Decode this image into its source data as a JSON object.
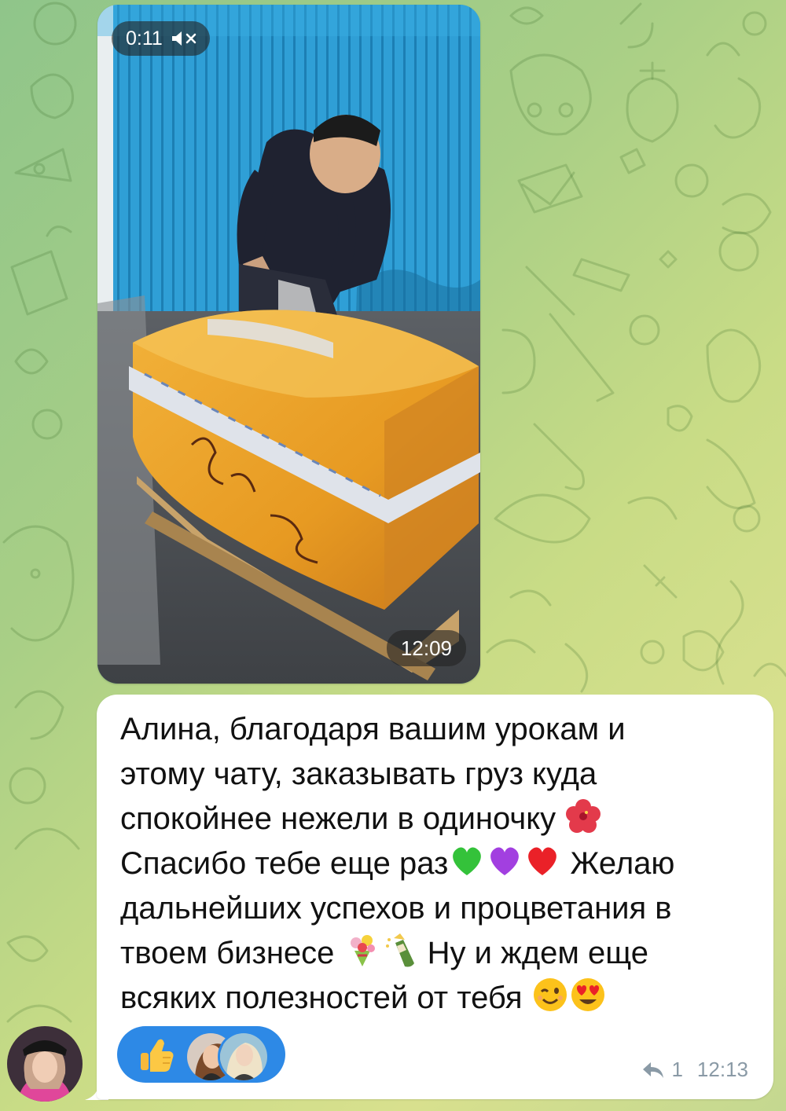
{
  "video_message": {
    "duration": "0:11",
    "sound_state_icon": "muted-speaker-icon",
    "time": "12:09"
  },
  "text_message": {
    "segments": [
      {
        "text": "Алина, благодаря вашим урокам и\nэтому чату, заказывать груз куда\nспокойнее нежели в одиночку "
      },
      {
        "emoji": "hibiscus"
      },
      {
        "text": "\nСпасибо тебе еще раз"
      },
      {
        "emoji": "green-heart"
      },
      {
        "emoji": "purple-heart"
      },
      {
        "emoji": "red-heart"
      },
      {
        "text": " Желаю\nдальнейших успехов и процветания в\nтвоем бизнесе "
      },
      {
        "emoji": "bouquet"
      },
      {
        "emoji": "champagne"
      },
      {
        "text": " Ну и ждем еще\nвсяких полезностей от тебя "
      },
      {
        "emoji": "winking-face"
      },
      {
        "emoji": "heart-eyes-face"
      }
    ],
    "reactions": {
      "emoji": "thumbs-up",
      "reactor_avatars": [
        "reactor-avatar-1",
        "reactor-avatar-2"
      ]
    },
    "reply_count": "1",
    "time": "12:13"
  },
  "colors": {
    "reaction_pill": "#2d89e6",
    "meta_text": "#8a9aa6",
    "bubble": "#ffffff"
  }
}
